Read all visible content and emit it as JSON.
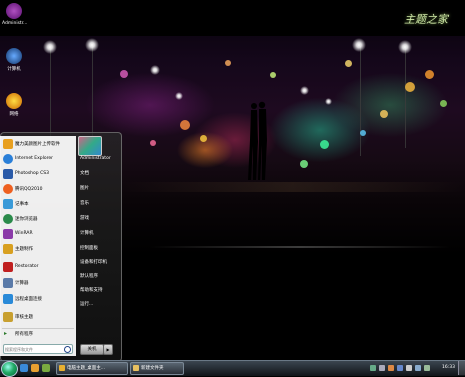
{
  "desktop": {
    "icons": [
      {
        "label": "Administr...",
        "icon": "user-folder-icon"
      },
      {
        "label": "计算机",
        "icon": "computer-icon"
      },
      {
        "label": "网络",
        "icon": "network-icon"
      }
    ],
    "watermark": "主题之家"
  },
  "start_menu": {
    "programs": [
      {
        "label": "魔力美颜图片上传软件",
        "icon": "photo-upload-icon",
        "color": "#e8a020"
      },
      {
        "label": "Internet Explorer",
        "icon": "internet-explorer-icon",
        "color": "#2a7fd8"
      },
      {
        "label": "Photoshop CS3",
        "icon": "photoshop-icon",
        "color": "#2a5aa8"
      },
      {
        "label": "腾讯QQ2010",
        "icon": "qq-icon",
        "color": "#ee6020"
      },
      {
        "label": "记事本",
        "icon": "notepad-icon",
        "color": "#3a9ad8"
      },
      {
        "label": "迷你浏览器",
        "icon": "browser-icon",
        "color": "#2a8a4a"
      },
      {
        "label": "WinRAR",
        "icon": "winrar-icon",
        "color": "#8a3aa8"
      },
      {
        "label": "主题制作",
        "icon": "theme-maker-icon",
        "color": "#d8a020"
      },
      {
        "label": "Restorator",
        "icon": "restorator-icon",
        "color": "#c02020"
      },
      {
        "label": "计算器",
        "icon": "calculator-icon",
        "color": "#5a7aa8"
      },
      {
        "label": "远程桌面连接",
        "icon": "remote-desktop-icon",
        "color": "#2a8ad8"
      },
      {
        "label": "审核主题",
        "icon": "review-theme-icon",
        "color": "#c8a030"
      }
    ],
    "all_programs": "所有程序",
    "search_placeholder": "搜索程序和文件",
    "user_name": "Administrator",
    "right_items": [
      "文档",
      "图片",
      "音乐",
      "游戏",
      "计算机",
      "控制面板",
      "设备和打印机",
      "默认程序",
      "帮助和支持",
      "运行..."
    ],
    "power_label": "关机",
    "power_arrow": "▶"
  },
  "taskbar": {
    "buttons": [
      {
        "label": "电脑主题_桌面主...",
        "icon": "browser-window-icon",
        "color": "#e8b030"
      },
      {
        "label": "新建文件夹",
        "icon": "folder-icon",
        "color": "#e8c060"
      }
    ],
    "clock": "16:33"
  }
}
